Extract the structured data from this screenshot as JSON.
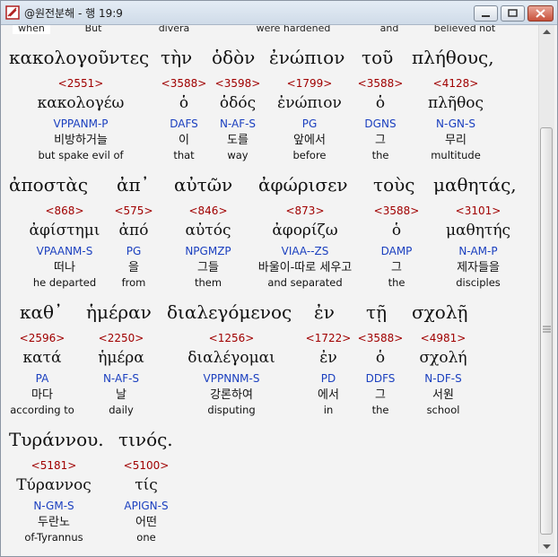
{
  "window": {
    "title": "@원전분해 - 행 19:9"
  },
  "header_row": [
    {
      "id": "when",
      "text": "when"
    },
    {
      "id": "but",
      "text": "But"
    },
    {
      "id": "divera",
      "text": "divera"
    },
    {
      "id": "hardened",
      "text": "were hardened"
    },
    {
      "id": "and",
      "text": "and"
    },
    {
      "id": "believed",
      "text": "believed not"
    }
  ],
  "lines": [
    {
      "greek": [
        "κακολογοῦντες",
        "τὴν",
        "ὁδὸν",
        "ἐνώπιον",
        "τοῦ",
        "πλήθους,"
      ],
      "entries": [
        {
          "num": "<2551>",
          "lexeme": "κακολογέω",
          "parse": "VPPANM-P",
          "korean": "비방하거늘",
          "english": "but spake evil of"
        },
        {
          "num": "<3588>",
          "lexeme": "ὁ",
          "parse": "DAFS",
          "korean": "이",
          "english": "that"
        },
        {
          "num": "<3598>",
          "lexeme": "ὁδός",
          "parse": "N-AF-S",
          "korean": "도를",
          "english": "way"
        },
        {
          "num": "<1799>",
          "lexeme": "ἐνώπιον",
          "parse": "PG",
          "korean": "앞에서",
          "english": "before"
        },
        {
          "num": "<3588>",
          "lexeme": "ὁ",
          "parse": "DGNS",
          "korean": "그",
          "english": "the"
        },
        {
          "num": "<4128>",
          "lexeme": "πλῆθος",
          "parse": "N-GN-S",
          "korean": "무리",
          "english": "multitude"
        }
      ]
    },
    {
      "greek": [
        "ἀποστὰς",
        "ἀπ᾽",
        "αὐτῶν",
        "ἀφώρισεν",
        "τοὺς",
        "μαθητάς,"
      ],
      "entries": [
        {
          "num": "<868>",
          "lexeme": "ἀφίστημι",
          "parse": "VPAANM-S",
          "korean": "떠나",
          "english": "he departed"
        },
        {
          "num": "<575>",
          "lexeme": "ἀπό",
          "parse": "PG",
          "korean": "을",
          "english": "from"
        },
        {
          "num": "<846>",
          "lexeme": "αὐτός",
          "parse": "NPGMZP",
          "korean": "그들",
          "english": "them"
        },
        {
          "num": "<873>",
          "lexeme": "ἀφορίζω",
          "parse": "VIAA--ZS",
          "korean": "바울이-따로 세우고",
          "english": "and separated"
        },
        {
          "num": "<3588>",
          "lexeme": "ὁ",
          "parse": "DAMP",
          "korean": "그",
          "english": "the"
        },
        {
          "num": "<3101>",
          "lexeme": "μαθητής",
          "parse": "N-AM-P",
          "korean": "제자들을",
          "english": "disciples"
        }
      ]
    },
    {
      "greek": [
        "καθ᾽",
        "ἡμέραν",
        "διαλεγόμενος",
        "ἐν",
        "τῇ",
        "σχολῇ"
      ],
      "entries": [
        {
          "num": "<2596>",
          "lexeme": "κατά",
          "parse": "PA",
          "korean": "마다",
          "english": "according to"
        },
        {
          "num": "<2250>",
          "lexeme": "ἡμέρα",
          "parse": "N-AF-S",
          "korean": "날",
          "english": "daily"
        },
        {
          "num": "<1256>",
          "lexeme": "διαλέγομαι",
          "parse": "VPPNNM-S",
          "korean": "강론하여",
          "english": "disputing"
        },
        {
          "num": "<1722>",
          "lexeme": "ἐν",
          "parse": "PD",
          "korean": "에서",
          "english": "in"
        },
        {
          "num": "<3588>",
          "lexeme": "ὁ",
          "parse": "DDFS",
          "korean": "그",
          "english": "the"
        },
        {
          "num": "<4981>",
          "lexeme": "σχολή",
          "parse": "N-DF-S",
          "korean": "서원",
          "english": "school"
        }
      ]
    },
    {
      "greek": [
        "Τυράννου.",
        "τινός."
      ],
      "entries": [
        {
          "num": "<5181>",
          "lexeme": "Τύραννος",
          "parse": "N-GM-S",
          "korean": "두란노",
          "english": "of-Tyrannus"
        },
        {
          "num": "<5100>",
          "lexeme": "τίς",
          "parse": "APIGN-S",
          "korean": "어떤",
          "english": "one"
        }
      ]
    }
  ]
}
